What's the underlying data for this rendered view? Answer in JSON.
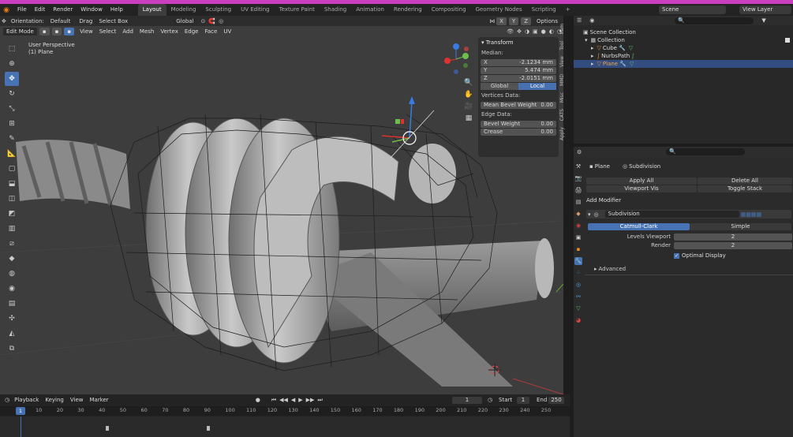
{
  "menu": {
    "items": [
      "File",
      "Edit",
      "Render",
      "Window",
      "Help"
    ]
  },
  "workspaces": [
    "Layout",
    "Modeling",
    "Sculpting",
    "UV Editing",
    "Texture Paint",
    "Shading",
    "Animation",
    "Rendering",
    "Compositing",
    "Geometry Nodes",
    "Scripting"
  ],
  "top_right": {
    "scene": "Scene",
    "view_layer": "View Layer"
  },
  "viewport": {
    "orientation_label": "Orientation:",
    "orientation_value": "Default",
    "drag_label": "Drag",
    "drag_value": "Select Box",
    "transform_space": "Global",
    "options_label": "Options",
    "mode": "Edit Mode",
    "menu": [
      "View",
      "Select",
      "Add",
      "Mesh",
      "Vertex",
      "Edge",
      "Face",
      "UV"
    ],
    "overlay_line1": "User Perspective",
    "overlay_line2": "(1) Plane",
    "axis_x": "X",
    "axis_y": "Y",
    "axis_z": "Z"
  },
  "npanel": {
    "title": "Transform",
    "median_label": "Median:",
    "x_label": "X",
    "x_value": "-2.1234 mm",
    "y_label": "Y",
    "y_value": "5.474 mm",
    "z_label": "Z",
    "z_value": "-2.0151 mm",
    "global": "Global",
    "local": "Local",
    "vertices_label": "Vertices Data:",
    "mean_bevel_label": "Mean Bevel Weight",
    "mean_bevel_value": "0.00",
    "edge_label": "Edge Data:",
    "bevel_label": "Bevel Weight",
    "bevel_value": "0.00",
    "crease_label": "Crease",
    "crease_value": "0.00",
    "tabs": [
      "Item",
      "Tool",
      "View",
      "MMD",
      "Misc",
      "CATS",
      "Apply"
    ]
  },
  "timeline": {
    "menu": [
      "Playback",
      "Keying",
      "View",
      "Marker"
    ],
    "current_frame": "1",
    "start_label": "Start",
    "start_value": "1",
    "end_label": "End",
    "end_value": "250",
    "ticks": [
      "1",
      "10",
      "20",
      "30",
      "40",
      "50",
      "60",
      "70",
      "80",
      "90",
      "100",
      "110",
      "120",
      "130",
      "140",
      "150",
      "160",
      "170",
      "180",
      "190",
      "200",
      "210",
      "220",
      "230",
      "240",
      "250"
    ]
  },
  "outliner": {
    "root": "Scene Collection",
    "collection": "Collection",
    "items": [
      "Cube",
      "NurbsPath",
      "Plane"
    ]
  },
  "properties": {
    "object_name": "Plane",
    "modifier_name_tab": "Subdivision",
    "apply_all": "Apply All",
    "delete_all": "Delete All",
    "viewport_vis": "Viewport Vis",
    "toggle_stack": "Toggle Stack",
    "add_modifier": "Add Modifier",
    "modifier_name": "Subdivision",
    "catmull": "Catmull-Clark",
    "simple": "Simple",
    "levels_label": "Levels Viewport",
    "levels_value": "2",
    "render_label": "Render",
    "render_value": "2",
    "optimal": "Optimal Display",
    "advanced": "Advanced"
  },
  "colors": {
    "accent": "#4772b3",
    "top_strip": "#c93fbd",
    "viewport_bg": "#3d3d3d"
  }
}
